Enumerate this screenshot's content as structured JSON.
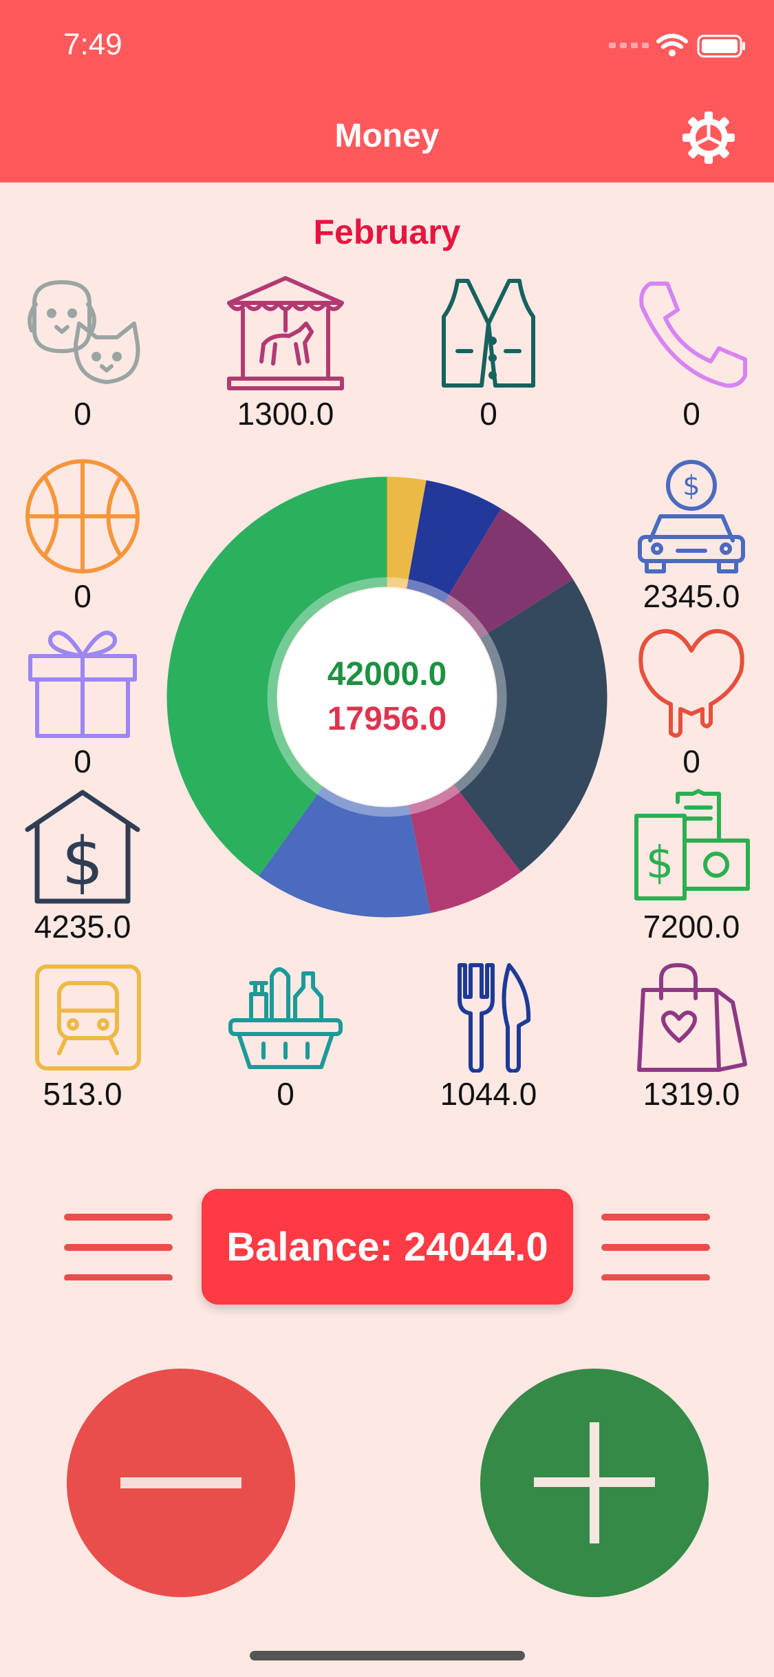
{
  "status_bar": {
    "time": "7:49"
  },
  "header": {
    "title": "Money"
  },
  "month": "February",
  "categories": [
    {
      "id": "pets",
      "icon": "pets-icon",
      "value": "0",
      "color": "#9AA5A3"
    },
    {
      "id": "entertainment",
      "icon": "carousel-icon",
      "value": "1300.0",
      "color": "#B23A73"
    },
    {
      "id": "clothes",
      "icon": "vest-icon",
      "value": "0",
      "color": "#16625E"
    },
    {
      "id": "phone",
      "icon": "phone-icon",
      "value": "0",
      "color": "#D784F2"
    },
    {
      "id": "sport",
      "icon": "basketball-icon",
      "value": "0",
      "color": "#F6963A"
    },
    {
      "id": "car",
      "icon": "car-icon",
      "value": "2345.0",
      "color": "#4A6BC0"
    },
    {
      "id": "gifts",
      "icon": "gift-icon",
      "value": "0",
      "color": "#9B86F2"
    },
    {
      "id": "health",
      "icon": "heart-icon",
      "value": "0",
      "color": "#E6503B"
    },
    {
      "id": "housing",
      "icon": "house-dollar-icon",
      "value": "4235.0",
      "color": "#2F3E55"
    },
    {
      "id": "salary",
      "icon": "cash-icon",
      "value": "7200.0",
      "color": "#2BB050"
    },
    {
      "id": "transport",
      "icon": "train-icon",
      "value": "513.0",
      "color": "#EDB946"
    },
    {
      "id": "groceries",
      "icon": "grocery-basket-icon",
      "value": "0",
      "color": "#1C9A98"
    },
    {
      "id": "food",
      "icon": "fork-knife-icon",
      "value": "1044.0",
      "color": "#1F3A96"
    },
    {
      "id": "shopping",
      "icon": "shopping-bag-icon",
      "value": "1319.0",
      "color": "#8E3983"
    }
  ],
  "donut": {
    "income_total": "42000.0",
    "expense_total": "17956.0",
    "slices": [
      {
        "value": 513.0,
        "color": "#EDB946"
      },
      {
        "value": 1044.0,
        "color": "#22399B"
      },
      {
        "value": 1319.0,
        "color": "#82366F"
      },
      {
        "value": 4235.0,
        "color": "#35495E"
      },
      {
        "value": 1300.0,
        "color": "#B23A73"
      },
      {
        "value": 2345.0,
        "color": "#4B6BBE"
      },
      {
        "value": 7200.0,
        "color": "#2BB05E"
      }
    ]
  },
  "balance": {
    "text": "Balance: 24044.0"
  }
}
